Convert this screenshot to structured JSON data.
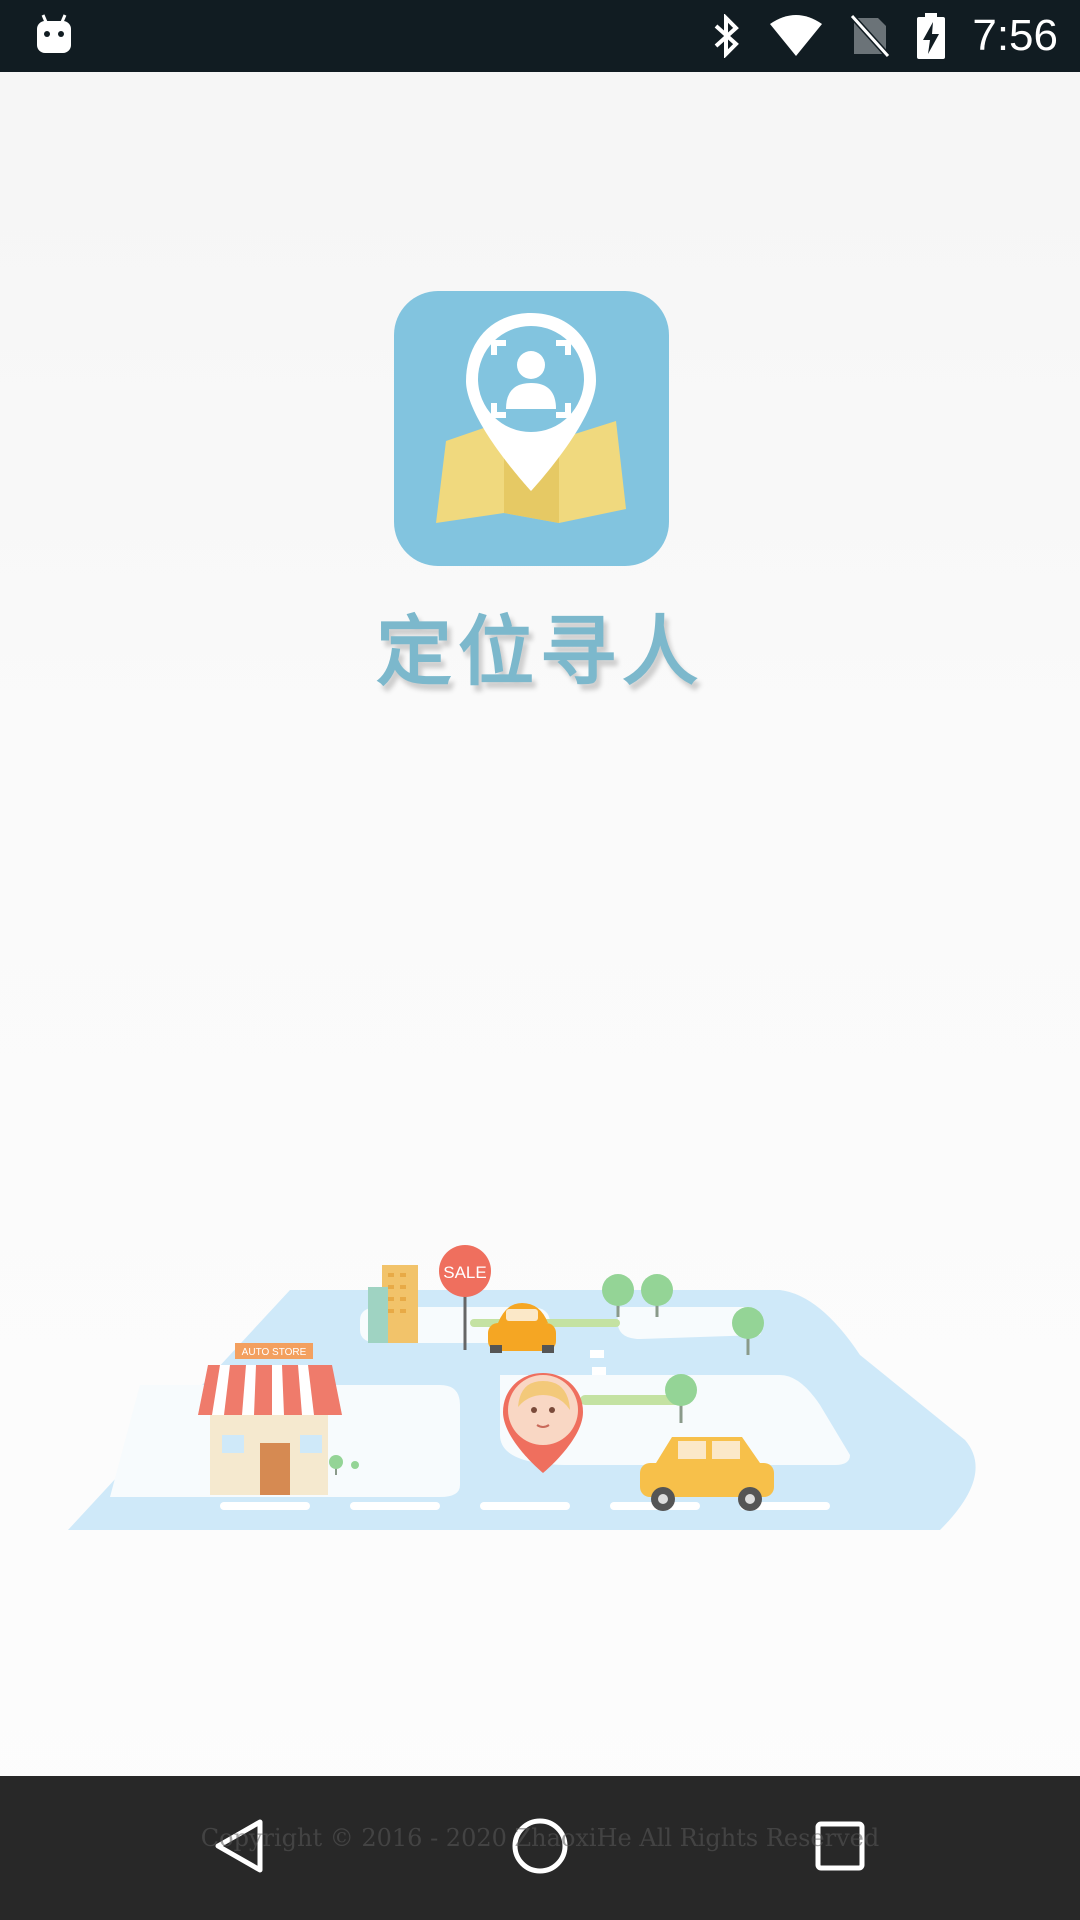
{
  "status_bar": {
    "time": "7:56",
    "icons": [
      "android-notification-icon",
      "bluetooth-icon",
      "wifi-icon",
      "no-sim-icon",
      "battery-charging-icon"
    ]
  },
  "splash": {
    "app_name": "定位寻人",
    "logo_icon": "location-pin-person-map-icon",
    "illustration": {
      "sign_text": "SALE",
      "store_text": "AUTO STORE"
    },
    "copyright": "Copyright © 2016 - 2020 ZhaoxiHe All Rights Reserved"
  },
  "nav_bar": {
    "buttons": [
      "back-icon",
      "home-icon",
      "recents-icon"
    ]
  },
  "colors": {
    "status_bar_bg": "#111c22",
    "logo_bg": "#82c4df",
    "map_yellow": "#f0d97e",
    "title_color": "#7cb8cc",
    "nav_bar_bg": "#242424"
  }
}
